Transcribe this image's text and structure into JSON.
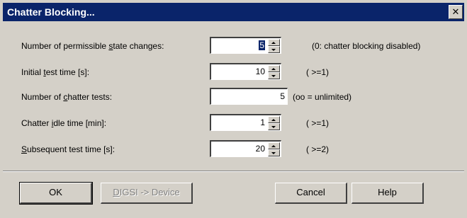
{
  "dialog": {
    "title": "Chatter Blocking...",
    "close_glyph": "✕"
  },
  "fields": [
    {
      "label_pre": "Number of permissible ",
      "label_u": "s",
      "label_post": "tate changes:",
      "value": "5",
      "hint": "(0: chatter blocking disabled)"
    },
    {
      "label_pre": "Initial ",
      "label_u": "t",
      "label_post": "est time [s]:",
      "value": "10",
      "hint": "( >=1)"
    },
    {
      "label_pre": "Number of ",
      "label_u": "c",
      "label_post": "hatter tests:",
      "value": "5",
      "hint": "(oo = unlimited)"
    },
    {
      "label_pre": "Chatter ",
      "label_u": "i",
      "label_post": "dle time [min]:",
      "value": "1",
      "hint": "( >=1)"
    },
    {
      "label_pre": "",
      "label_u": "S",
      "label_post": "ubsequent test time [s]:",
      "value": "20",
      "hint": "( >=2)"
    }
  ],
  "buttons": {
    "ok": "OK",
    "digsi_u": "D",
    "digsi_rest": "IGSI -> Device",
    "cancel": "Cancel",
    "help": "Help"
  }
}
